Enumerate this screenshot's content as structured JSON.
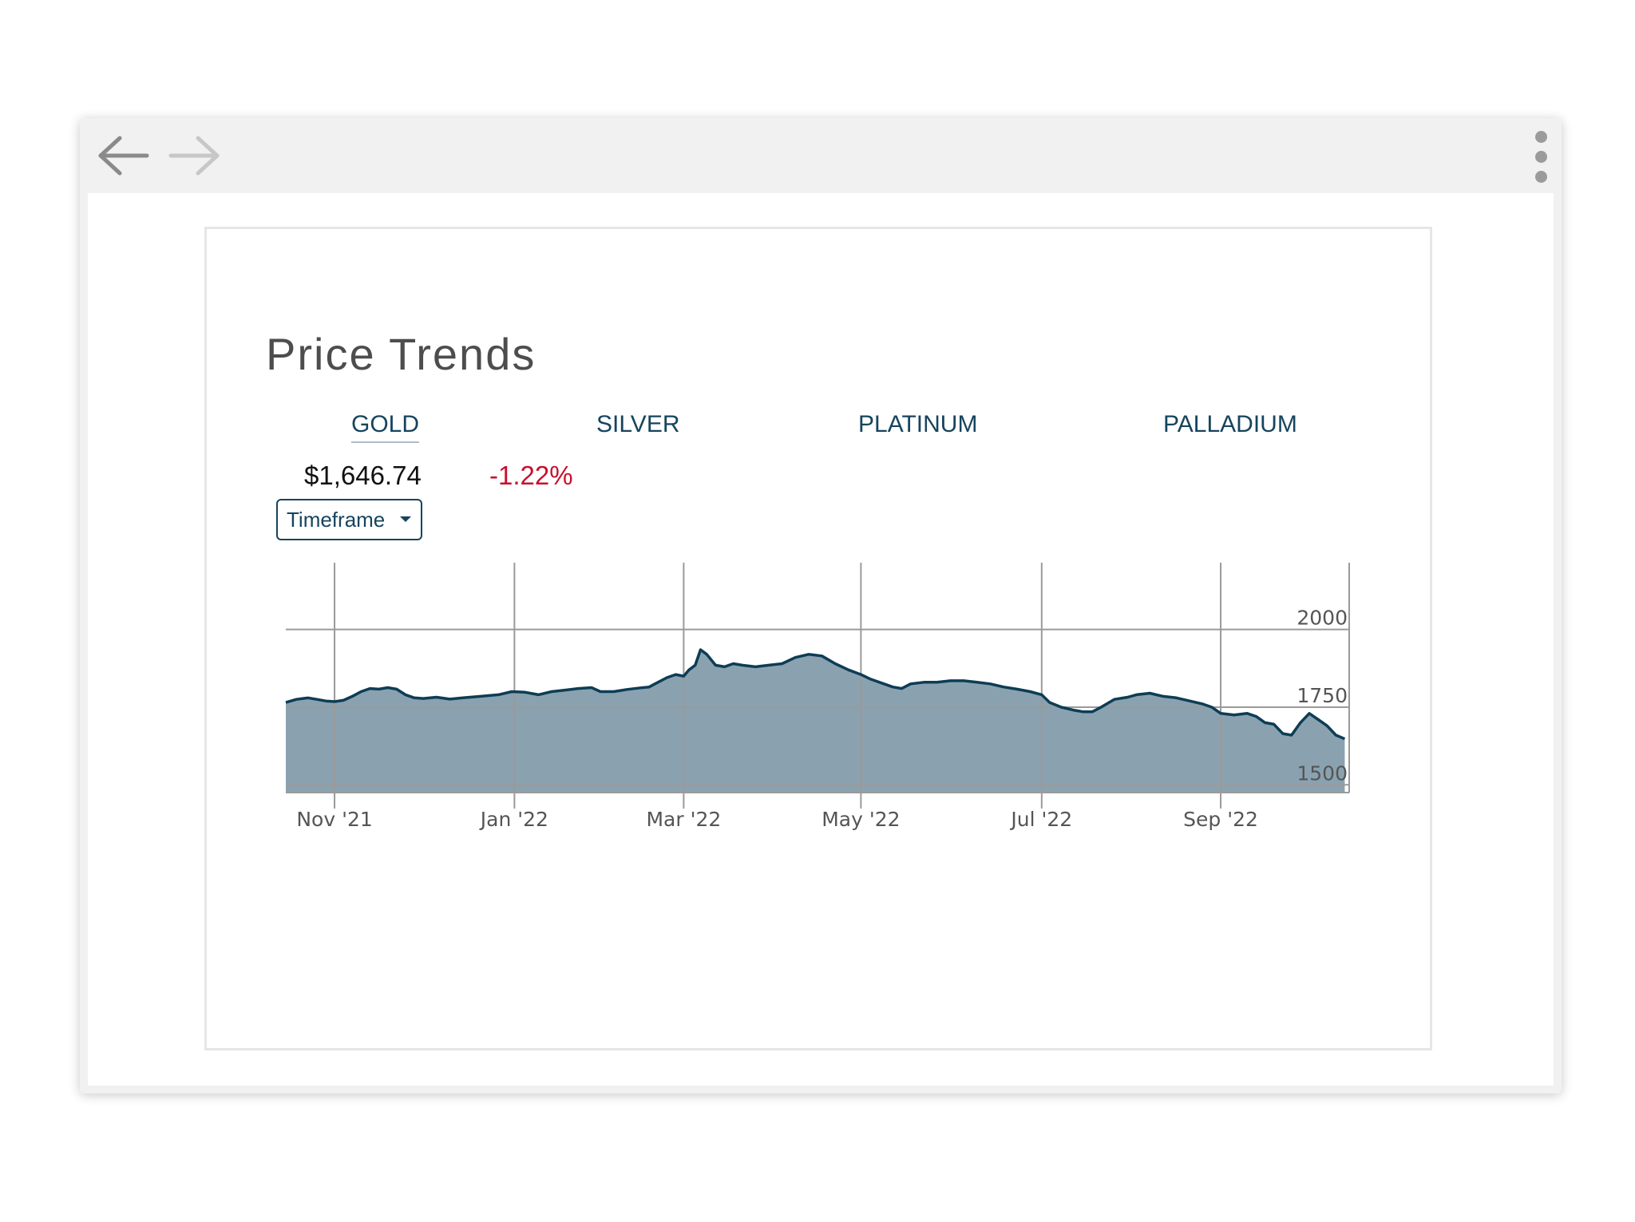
{
  "browser": {
    "icons": {
      "back": "arrow-left-icon",
      "forward": "arrow-right-icon",
      "menu": "more-vertical-icon"
    }
  },
  "widget": {
    "title": "Price Trends",
    "tabs": [
      {
        "label": "GOLD",
        "active": true
      },
      {
        "label": "SILVER",
        "active": false
      },
      {
        "label": "PLATINUM",
        "active": false
      },
      {
        "label": "PALLADIUM",
        "active": false
      }
    ],
    "price": "$1,646.74",
    "change": "-1.22%",
    "timeframe_label": "Timeframe",
    "colors": {
      "accent": "#17445e",
      "negative": "#c8102e",
      "area_fill": "#8aa2b0",
      "line": "#0d3d55"
    }
  },
  "chart_data": {
    "type": "area",
    "x_tick_labels": [
      "Nov '21",
      "Jan '22",
      "Mar '22",
      "May '22",
      "Jul '22",
      "Sep '22"
    ],
    "y_tick_labels": [
      "2000",
      "1750",
      "1500"
    ],
    "y_ticks": [
      2000,
      1750,
      1500
    ],
    "ylim": [
      1475,
      2215
    ],
    "y_axis_side": "right",
    "grid": true,
    "x_start_month": "2021-10-15",
    "x_end_month": "2022-10-15",
    "x_tick_month_offsets": [
      0.55,
      2.58,
      4.49,
      6.49,
      8.53,
      10.55
    ],
    "series": [
      {
        "values": [
          [
            0.0,
            1765
          ],
          [
            0.12,
            1775
          ],
          [
            0.25,
            1780
          ],
          [
            0.35,
            1775
          ],
          [
            0.45,
            1770
          ],
          [
            0.55,
            1768
          ],
          [
            0.65,
            1772
          ],
          [
            0.75,
            1785
          ],
          [
            0.85,
            1800
          ],
          [
            0.95,
            1810
          ],
          [
            1.05,
            1808
          ],
          [
            1.15,
            1813
          ],
          [
            1.25,
            1808
          ],
          [
            1.35,
            1790
          ],
          [
            1.45,
            1780
          ],
          [
            1.55,
            1778
          ],
          [
            1.7,
            1782
          ],
          [
            1.85,
            1776
          ],
          [
            2.0,
            1780
          ],
          [
            2.2,
            1785
          ],
          [
            2.4,
            1790
          ],
          [
            2.55,
            1800
          ],
          [
            2.7,
            1798
          ],
          [
            2.85,
            1790
          ],
          [
            3.0,
            1800
          ],
          [
            3.15,
            1805
          ],
          [
            3.3,
            1810
          ],
          [
            3.45,
            1813
          ],
          [
            3.55,
            1800
          ],
          [
            3.7,
            1800
          ],
          [
            3.85,
            1807
          ],
          [
            4.0,
            1812
          ],
          [
            4.1,
            1815
          ],
          [
            4.2,
            1830
          ],
          [
            4.3,
            1845
          ],
          [
            4.4,
            1855
          ],
          [
            4.49,
            1850
          ],
          [
            4.55,
            1870
          ],
          [
            4.62,
            1885
          ],
          [
            4.68,
            1935
          ],
          [
            4.75,
            1920
          ],
          [
            4.85,
            1885
          ],
          [
            4.95,
            1880
          ],
          [
            5.05,
            1890
          ],
          [
            5.15,
            1885
          ],
          [
            5.3,
            1880
          ],
          [
            5.45,
            1885
          ],
          [
            5.6,
            1890
          ],
          [
            5.75,
            1910
          ],
          [
            5.9,
            1920
          ],
          [
            6.05,
            1915
          ],
          [
            6.2,
            1890
          ],
          [
            6.35,
            1870
          ],
          [
            6.49,
            1855
          ],
          [
            6.6,
            1840
          ],
          [
            6.75,
            1825
          ],
          [
            6.85,
            1815
          ],
          [
            6.95,
            1810
          ],
          [
            7.05,
            1825
          ],
          [
            7.2,
            1830
          ],
          [
            7.35,
            1830
          ],
          [
            7.5,
            1835
          ],
          [
            7.65,
            1835
          ],
          [
            7.8,
            1830
          ],
          [
            7.95,
            1825
          ],
          [
            8.1,
            1815
          ],
          [
            8.25,
            1808
          ],
          [
            8.4,
            1800
          ],
          [
            8.53,
            1790
          ],
          [
            8.62,
            1765
          ],
          [
            8.75,
            1750
          ],
          [
            8.9,
            1740
          ],
          [
            9.0,
            1735
          ],
          [
            9.1,
            1735
          ],
          [
            9.2,
            1750
          ],
          [
            9.35,
            1775
          ],
          [
            9.5,
            1782
          ],
          [
            9.6,
            1790
          ],
          [
            9.75,
            1795
          ],
          [
            9.9,
            1785
          ],
          [
            10.05,
            1780
          ],
          [
            10.2,
            1770
          ],
          [
            10.35,
            1760
          ],
          [
            10.45,
            1750
          ],
          [
            10.55,
            1730
          ],
          [
            10.7,
            1725
          ],
          [
            10.85,
            1730
          ],
          [
            10.95,
            1720
          ],
          [
            11.05,
            1700
          ],
          [
            11.15,
            1695
          ],
          [
            11.25,
            1665
          ],
          [
            11.35,
            1660
          ],
          [
            11.45,
            1700
          ],
          [
            11.55,
            1730
          ],
          [
            11.65,
            1710
          ],
          [
            11.75,
            1690
          ],
          [
            11.85,
            1660
          ],
          [
            11.95,
            1648
          ]
        ]
      }
    ]
  }
}
